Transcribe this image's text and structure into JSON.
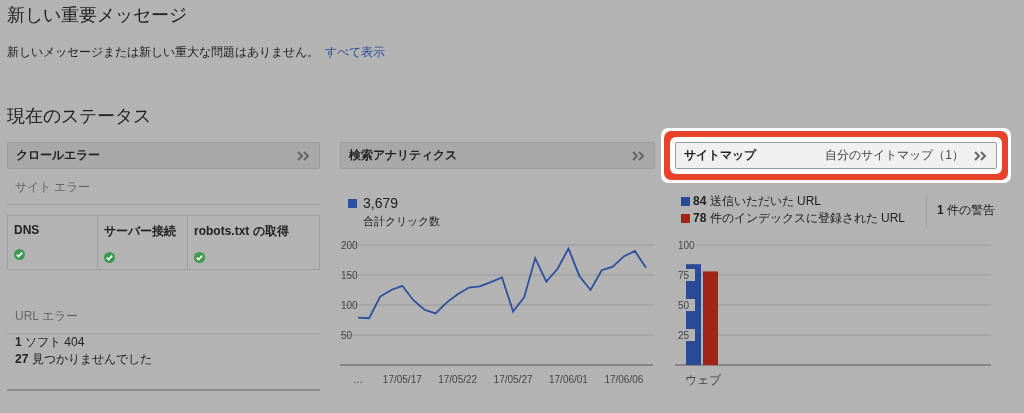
{
  "messages": {
    "title": "新しい重要メッセージ",
    "text": "新しいメッセージまたは新しい重大な問題はありません。",
    "link": "すべて表示"
  },
  "status": {
    "title": "現在のステータス"
  },
  "crawl_errors": {
    "header": "クロールエラー",
    "site_errors_label": "サイト エラー",
    "site_checks": [
      {
        "label": "DNS",
        "ok": true
      },
      {
        "label": "サーバー接続",
        "ok": true
      },
      {
        "label": "robots.txt の取得",
        "ok": true
      }
    ],
    "url_errors_label": "URL エラー",
    "url_errors": [
      "**1** ソフト 404",
      "**27** 見つかりませんでした"
    ]
  },
  "search_analytics": {
    "header": "検索アナリティクス",
    "total": "3,679",
    "total_label": "合計クリック数",
    "chart_data": {
      "type": "line",
      "categories": [
        "…",
        null,
        null,
        null,
        "17/05/17",
        null,
        null,
        null,
        null,
        "17/05/22",
        null,
        null,
        null,
        null,
        "17/05/27",
        null,
        null,
        null,
        null,
        "17/06/01",
        null,
        null,
        null,
        null,
        "17/06/06",
        null,
        null
      ],
      "grid": true,
      "series": [
        {
          "color": "#2c4f9e",
          "values": [
            79,
            78,
            114,
            125,
            132,
            108,
            92,
            86,
            104,
            118,
            129,
            131,
            138,
            146,
            89,
            113,
            178,
            139,
            160,
            194,
            148,
            125,
            158,
            164,
            181,
            190,
            162
          ]
        }
      ],
      "ylim": [
        0,
        200
      ],
      "yticks": [
        50,
        100,
        150,
        200
      ]
    }
  },
  "sitemaps": {
    "header": "サイトマップ",
    "link": "自分のサイトマップ（1）",
    "highlighted": true,
    "legend": [
      {
        "text": "**84** 送信いただいた URL",
        "color": "#2a4a98"
      },
      {
        "text": "**78** 件のインデックスに登録された URL",
        "color": "#a02418"
      }
    ],
    "warnings": "**1** 件の警告",
    "chart_data": {
      "type": "bar",
      "categories": [
        "ウェブ"
      ],
      "series": [
        {
          "color": "#2a4a98",
          "values": [
            84
          ]
        },
        {
          "color": "#a02418",
          "values": [
            78
          ]
        }
      ],
      "ylim": [
        0,
        100
      ],
      "yticks": [
        25,
        50,
        75,
        100
      ],
      "grid": true
    }
  }
}
